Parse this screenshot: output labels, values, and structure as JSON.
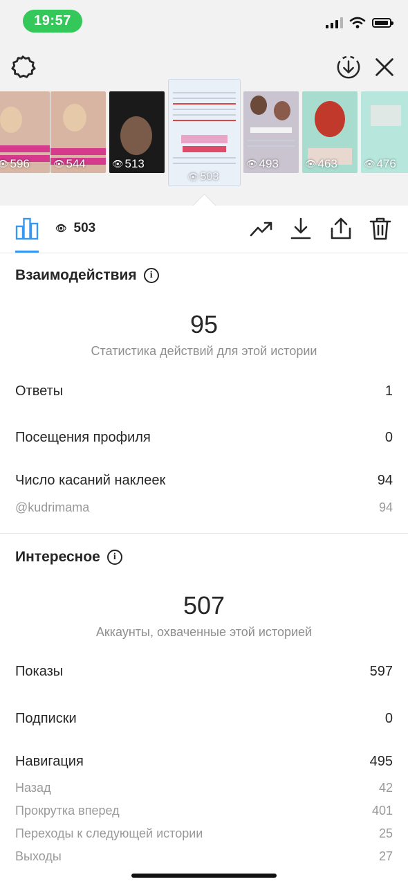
{
  "status": {
    "time": "19:57"
  },
  "stories": [
    {
      "views": "596",
      "bg": "#d9b7a6",
      "sticker": "@KUDRIMAMA"
    },
    {
      "views": "544",
      "bg": "#d8b4a3",
      "sticker": "@KUDRIMAMA"
    },
    {
      "views": "513",
      "bg": "#1a1a1a",
      "sticker": ""
    },
    {
      "views": "503",
      "bg": "#eaf0f8",
      "sticker": "@KUDRIMAMA",
      "selected": true
    },
    {
      "views": "493",
      "bg": "#c9c4cf",
      "sticker": "@KUDRIMAMA"
    },
    {
      "views": "463",
      "bg": "#a8dccf",
      "sticker": ""
    },
    {
      "views": "476",
      "bg": "#b6e6dc",
      "sticker": ""
    }
  ],
  "toolbar": {
    "views": "503"
  },
  "interactions": {
    "title": "Взаимодействия",
    "total": "95",
    "caption": "Статистика действий для этой истории",
    "rows": [
      {
        "label": "Ответы",
        "value": "1"
      },
      {
        "label": "Посещения профиля",
        "value": "0"
      },
      {
        "label": "Число касаний наклеек",
        "value": "94"
      }
    ],
    "sub_rows": [
      {
        "label": "@kudrimama",
        "value": "94"
      }
    ]
  },
  "discovery": {
    "title": "Интересное",
    "total": "507",
    "caption": "Аккаунты, охваченные этой историей",
    "rows": [
      {
        "label": "Показы",
        "value": "597"
      },
      {
        "label": "Подписки",
        "value": "0"
      },
      {
        "label": "Навигация",
        "value": "495"
      }
    ],
    "sub_rows": [
      {
        "label": "Назад",
        "value": "42"
      },
      {
        "label": "Прокрутка вперед",
        "value": "401"
      },
      {
        "label": "Переходы к следующей истории",
        "value": "25"
      },
      {
        "label": "Выходы",
        "value": "27"
      }
    ]
  },
  "colors": {
    "accent": "#3897f0",
    "status_green": "#34c759",
    "secondary_text": "#8e8e8e"
  },
  "icons": [
    "gear-icon",
    "download-circle-icon",
    "close-icon",
    "bar-chart-icon",
    "eye-icon",
    "trend-icon",
    "download-icon",
    "share-icon",
    "trash-icon",
    "info-icon"
  ]
}
